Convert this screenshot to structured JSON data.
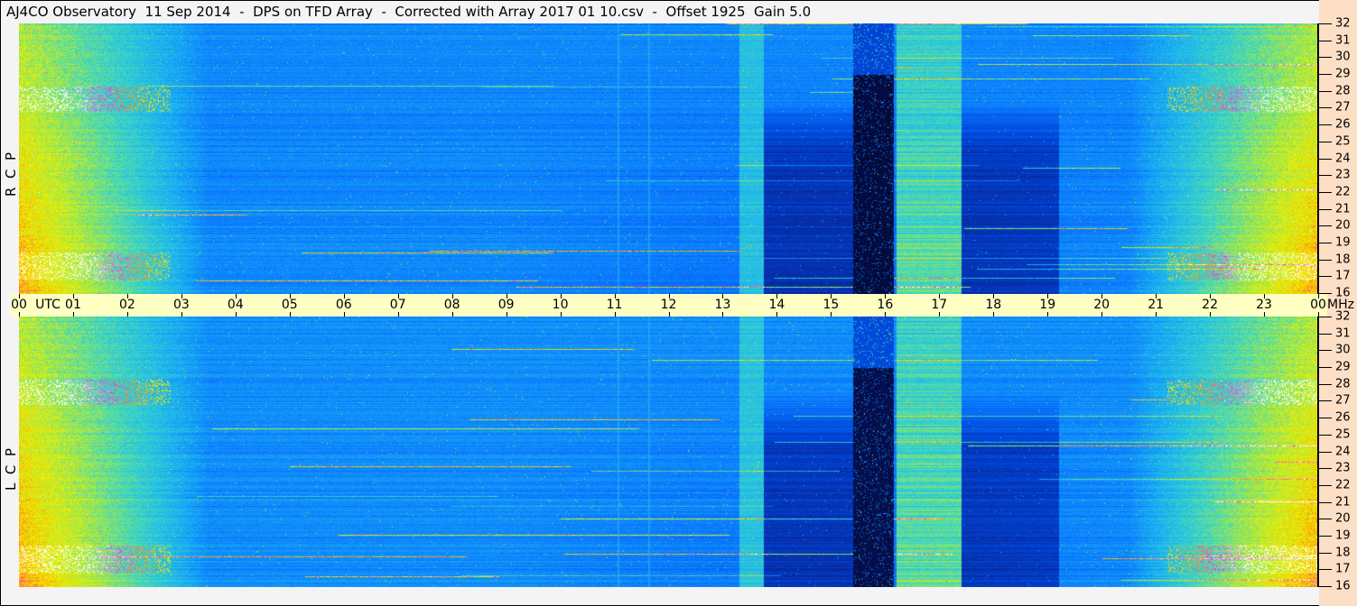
{
  "title": "AJ4CO Observatory  11 Sep 2014  -  DPS on TFD Array  -  Corrected with Array 2017 01 10.csv  -  Offset 1925  Gain 5.0",
  "chart_data": {
    "type": "heatmap",
    "title": "AJ4CO Observatory  11 Sep 2014  -  DPS on TFD Array  -  Corrected with Array 2017 01 10.csv  -  Offset 1925  Gain 5.0",
    "xlabel": "UTC",
    "ylabel": "MHz",
    "xlim": [
      0,
      24
    ],
    "ylim": [
      16,
      32
    ],
    "x_tick_labels": [
      "00",
      "01",
      "02",
      "03",
      "04",
      "05",
      "06",
      "07",
      "08",
      "09",
      "10",
      "11",
      "12",
      "13",
      "14",
      "15",
      "16",
      "17",
      "18",
      "19",
      "20",
      "21",
      "22",
      "23",
      "00"
    ],
    "y_tick_labels": [
      "32",
      "31",
      "30",
      "29",
      "28",
      "27",
      "26",
      "25",
      "24",
      "23",
      "22",
      "21",
      "20",
      "19",
      "18",
      "17",
      "16"
    ],
    "panels": [
      {
        "name": "RCP",
        "label": "R  C  P"
      },
      {
        "name": "LCP",
        "label": "L  C  P"
      }
    ],
    "features": {
      "black_band_utc": [
        15.4,
        16.15
      ],
      "bright_band_utc": [
        16.2,
        17.4
      ],
      "cyan_band_utc": [
        13.3,
        13.75
      ],
      "dark_region_utc": [
        [
          13.75,
          15.4
        ],
        [
          17.4,
          19.2
        ]
      ],
      "daytime_edges_utc": [
        [
          0,
          3.5
        ],
        [
          20.5,
          24
        ]
      ]
    },
    "colormap": [
      "#000010",
      "#0a1f8a",
      "#0046d8",
      "#0a78ff",
      "#1cb4f0",
      "#40d8c0",
      "#a8e840",
      "#f0f000",
      "#ffa000",
      "#ff20ff",
      "#ffffff"
    ]
  }
}
